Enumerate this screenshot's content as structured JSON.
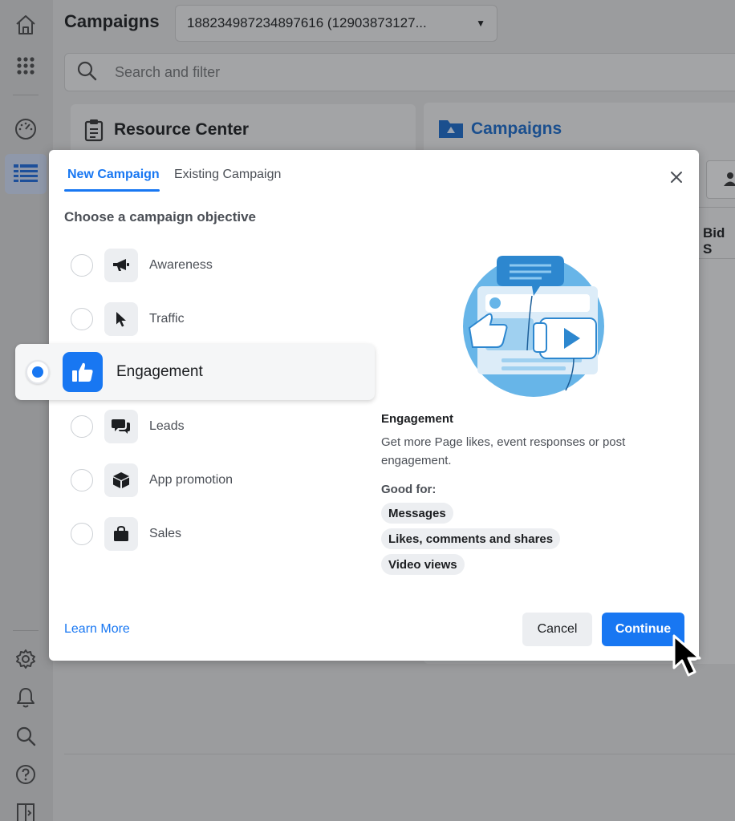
{
  "header": {
    "title": "Campaigns",
    "account_selector": "188234987234897616 (12903873127...",
    "search_placeholder": "Search and filter"
  },
  "background": {
    "resource_center_title": "Resource Center",
    "campaigns_panel_title": "Campaigns",
    "bid_column_fragment": "Bid S"
  },
  "modal": {
    "tabs": [
      {
        "label": "New Campaign",
        "active": true
      },
      {
        "label": "Existing Campaign",
        "active": false
      }
    ],
    "section_title": "Choose a campaign objective",
    "objectives": [
      {
        "label": "Awareness",
        "icon": "megaphone-icon",
        "selected": false
      },
      {
        "label": "Traffic",
        "icon": "pointer-icon",
        "selected": false
      },
      {
        "label": "Engagement",
        "icon": "thumbs-up-icon",
        "selected": true
      },
      {
        "label": "Leads",
        "icon": "chat-bubbles-icon",
        "selected": false
      },
      {
        "label": "App promotion",
        "icon": "box-icon",
        "selected": false
      },
      {
        "label": "Sales",
        "icon": "shopping-bag-icon",
        "selected": false
      }
    ],
    "detail": {
      "title": "Engagement",
      "description": "Get more Page likes, event responses or post engagement.",
      "good_for_label": "Good for:",
      "good_for": [
        "Messages",
        "Likes, comments and shares",
        "Video views"
      ]
    },
    "learn_more": "Learn More",
    "cancel": "Cancel",
    "continue": "Continue"
  },
  "colors": {
    "accent": "#1877f2",
    "overlay": "#9b9c9e"
  }
}
